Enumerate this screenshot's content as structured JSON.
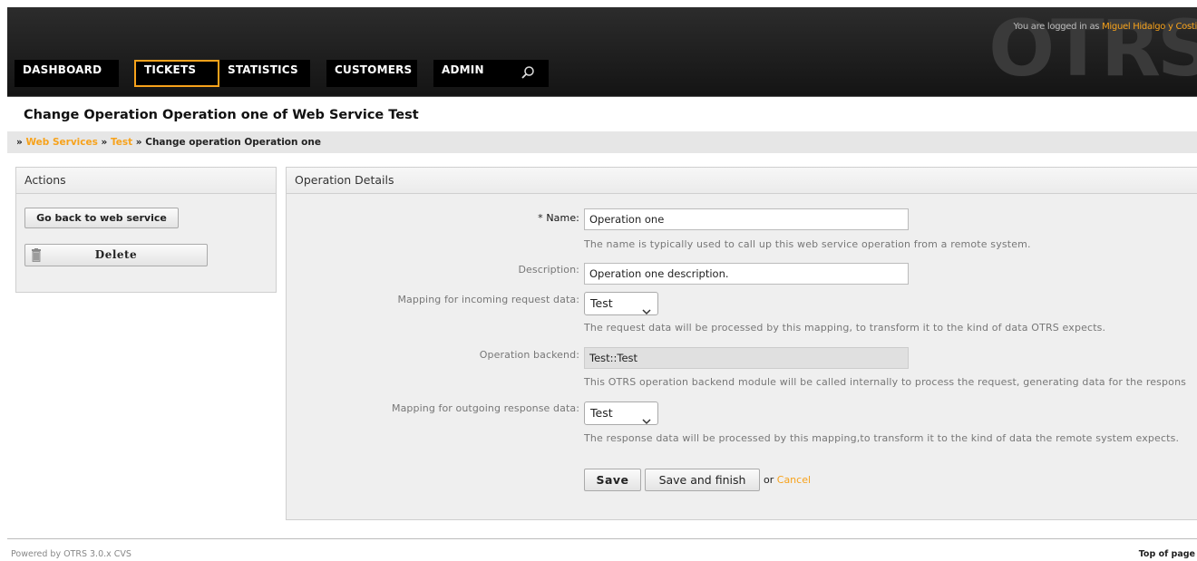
{
  "header": {
    "logo_text": "OTRS",
    "login_prefix": "You are logged in as",
    "user_name": "Miguel Hidalgo y Costi",
    "accent_color": "#f7a21b"
  },
  "nav": {
    "items": [
      {
        "label": "DASHBOARD",
        "active": false
      },
      {
        "label": "TICKETS",
        "active": true
      },
      {
        "label": "STATISTICS",
        "active": false
      },
      {
        "label": "CUSTOMERS",
        "active": false
      },
      {
        "label": "ADMIN",
        "active": false
      }
    ],
    "search_icon": "search-icon"
  },
  "page_title": "Change Operation Operation one of Web Service Test",
  "breadcrumb": {
    "sep": "»",
    "items": [
      "Web Services",
      "Test"
    ],
    "current": "Change operation Operation one"
  },
  "sidebar": {
    "title": "Actions",
    "back_button": "Go back to web service",
    "delete_button": "Delete",
    "delete_icon": "trash-icon"
  },
  "main": {
    "title": "Operation Details",
    "name": {
      "star": "*",
      "label": "Name:",
      "value": "Operation one",
      "hint": "The name is typically used to call up this web service operation from a remote system."
    },
    "description": {
      "label": "Description:",
      "value": "Operation one description."
    },
    "incoming": {
      "label": "Mapping for incoming request data:",
      "selected": "Test",
      "hint": "The request data will be processed by this mapping, to transform it to the kind of data OTRS expects."
    },
    "backend": {
      "label": "Operation backend:",
      "value": "Test::Test",
      "hint": "This OTRS operation backend module will be called internally to process the request, generating data for the respons"
    },
    "outgoing": {
      "label": "Mapping for outgoing response data:",
      "selected": "Test",
      "hint": "The response data will be processed by this mapping,to  transform it to the kind of data the remote system expects."
    },
    "save_button": "Save",
    "save_finish_button": "Save and finish",
    "or_text": "or",
    "cancel_link": "Cancel"
  },
  "footer": {
    "powered": "Powered by OTRS 3.0.x CVS",
    "top_link": "Top of page"
  }
}
